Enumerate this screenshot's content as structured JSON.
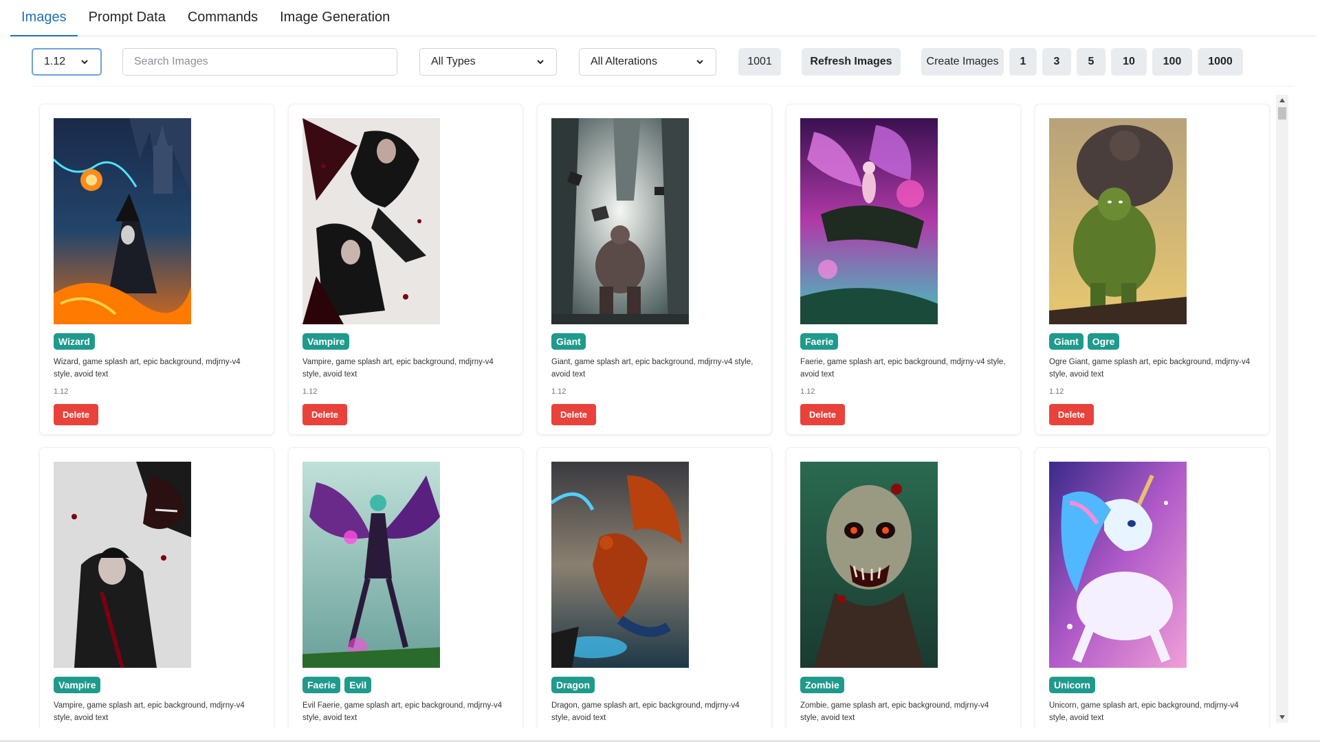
{
  "tabs": [
    {
      "label": "Images",
      "active": true
    },
    {
      "label": "Prompt Data",
      "active": false
    },
    {
      "label": "Commands",
      "active": false
    },
    {
      "label": "Image Generation",
      "active": false
    }
  ],
  "toolbar": {
    "version_select": "1.12",
    "search_placeholder": "Search Images",
    "type_select": "All Types",
    "alteration_select": "All Alterations",
    "count": "1001",
    "refresh_label": "Refresh Images",
    "create_label": "Create Images",
    "quantities": [
      "1",
      "3",
      "5",
      "10",
      "100",
      "1000"
    ]
  },
  "cards": [
    {
      "tags": [
        "Wizard"
      ],
      "description": "Wizard, game splash art, epic background, mdjrny-v4 style, avoid text",
      "version": "1.12",
      "delete_label": "Delete",
      "image": "wizard-art"
    },
    {
      "tags": [
        "Vampire"
      ],
      "description": "Vampire, game splash art, epic background, mdjrny-v4 style, avoid text",
      "version": "1.12",
      "delete_label": "Delete",
      "image": "vampire-art"
    },
    {
      "tags": [
        "Giant"
      ],
      "description": "Giant, game splash art, epic background, mdjrny-v4 style, avoid text",
      "version": "1.12",
      "delete_label": "Delete",
      "image": "giant-art"
    },
    {
      "tags": [
        "Faerie"
      ],
      "description": "Faerie, game splash art, epic background, mdjrny-v4 style, avoid text",
      "version": "1.12",
      "delete_label": "Delete",
      "image": "faerie-art"
    },
    {
      "tags": [
        "Giant",
        "Ogre"
      ],
      "description": "Ogre Giant, game splash art, epic background, mdjrny-v4 style, avoid text",
      "version": "1.12",
      "delete_label": "Delete",
      "image": "ogre-art"
    },
    {
      "tags": [
        "Vampire"
      ],
      "description": "Vampire, game splash art, epic background, mdjrny-v4 style, avoid text",
      "version": "",
      "delete_label": "",
      "image": "vampire-art-2"
    },
    {
      "tags": [
        "Faerie",
        "Evil"
      ],
      "description": "Evil Faerie, game splash art, epic background, mdjrny-v4 style, avoid text",
      "version": "",
      "delete_label": "",
      "image": "evil-faerie-art"
    },
    {
      "tags": [
        "Dragon"
      ],
      "description": "Dragon, game splash art, epic background, mdjrny-v4 style, avoid text",
      "version": "",
      "delete_label": "",
      "image": "dragon-art"
    },
    {
      "tags": [
        "Zombie"
      ],
      "description": "Zombie, game splash art, epic background, mdjrny-v4 style, avoid text",
      "version": "",
      "delete_label": "",
      "image": "zombie-art"
    },
    {
      "tags": [
        "Unicorn"
      ],
      "description": "Unicorn, game splash art, epic background, mdjrny-v4 style, avoid text",
      "version": "",
      "delete_label": "",
      "image": "unicorn-art"
    }
  ]
}
